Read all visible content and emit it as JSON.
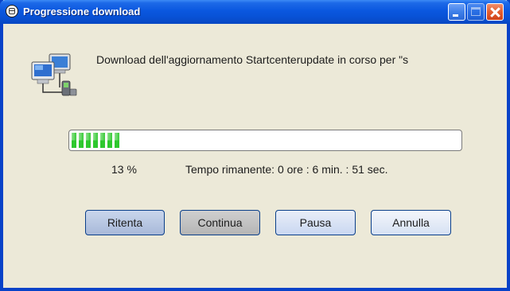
{
  "window": {
    "title": "Progressione download"
  },
  "dialog": {
    "message": "Download dell'aggiornamento Startcenterupdate in corso per \"s",
    "progress_percent": 13,
    "percent_label": "13 %",
    "remaining_label": "Tempo rimanente: 0 ore : 6 min. : 51 sec."
  },
  "buttons": {
    "retry": "Ritenta",
    "continue": "Continua",
    "pause": "Pausa",
    "cancel": "Annulla"
  },
  "icons": {
    "app": "app-globe-icon",
    "dialog": "network-computers-icon"
  },
  "colors": {
    "titlebar": "#0852d6",
    "progress_fill": "#2ec82e",
    "close_button": "#e35e2f"
  }
}
